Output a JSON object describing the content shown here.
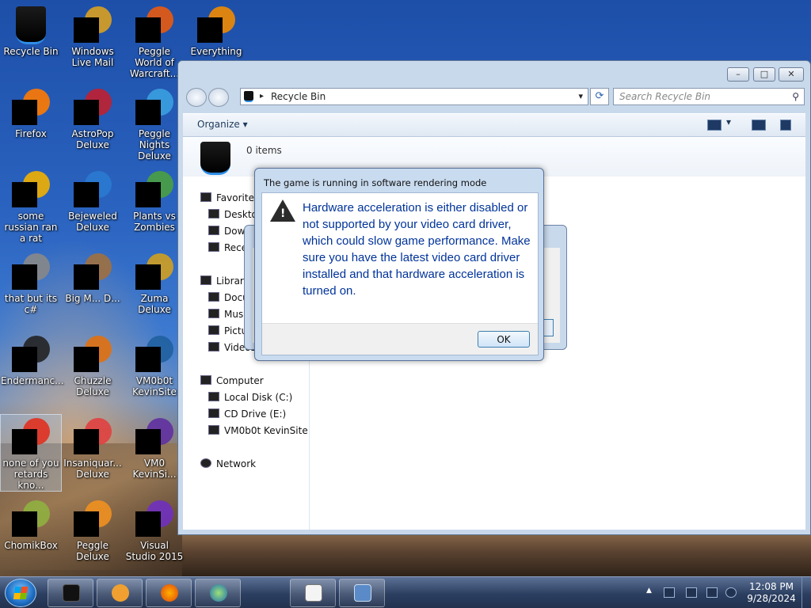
{
  "desktop": {
    "icons": [
      {
        "label": "Recycle Bin"
      },
      {
        "label": "Windows Live Mail"
      },
      {
        "label": "Peggle World of Warcraft..."
      },
      {
        "label": "Everything"
      },
      {
        "label": "Firefox"
      },
      {
        "label": "AstroPop Deluxe"
      },
      {
        "label": "Peggle Nights Deluxe"
      },
      {
        "label": "some russian ran a rat"
      },
      {
        "label": "Bejeweled Deluxe"
      },
      {
        "label": "Plants vs Zombies"
      },
      {
        "label": "that but its c#"
      },
      {
        "label": "Big M... D..."
      },
      {
        "label": "Zuma Deluxe"
      },
      {
        "label": "Endermanc..."
      },
      {
        "label": "Chuzzle Deluxe"
      },
      {
        "label": "VM0b0t KevinSite"
      },
      {
        "label": "none of you retards kno..."
      },
      {
        "label": "Insaniquar... Deluxe"
      },
      {
        "label": "VM0 KevinSi..."
      },
      {
        "label": "ChomikBox"
      },
      {
        "label": "Peggle Deluxe"
      },
      {
        "label": "Visual Studio 2015"
      }
    ]
  },
  "explorer": {
    "address": "Recycle Bin",
    "search_placeholder": "Search Recycle Bin",
    "organize": "Organize",
    "item_count": "0 items",
    "nav": {
      "favorites": "Favorites",
      "fav_items": [
        "Desktop",
        "Downloads",
        "Recent Places"
      ],
      "libraries": "Libraries",
      "lib_items": [
        "Documents",
        "Music",
        "Pictures",
        "Videos"
      ],
      "computer": "Computer",
      "computer_items": [
        "Local Disk (C:)",
        "CD Drive (E:)",
        "VM0b0t KevinSite"
      ],
      "network": "Network"
    }
  },
  "dialog": {
    "title": "The game is running in software rendering mode",
    "message": "Hardware acceleration is either disabled or not supported by your video card driver, which could slow game performance. Make sure you have the latest video card driver installed and that hardware acceleration is turned on.",
    "ok": "OK",
    "warning_glyph": "!"
  },
  "taskbar": {
    "time": "12:08 PM",
    "date": "9/28/2024",
    "overflow_glyph": "▲"
  },
  "icons": {
    "back": "back-arrow-icon",
    "forward": "forward-arrow-icon",
    "refresh_glyph": "⟳",
    "search_glyph": "⚲",
    "dropdown_glyph": "▾",
    "crumb_glyph": "▸"
  },
  "colors": {
    "dialog_text": "#003399",
    "accent": "#2e8de6"
  }
}
